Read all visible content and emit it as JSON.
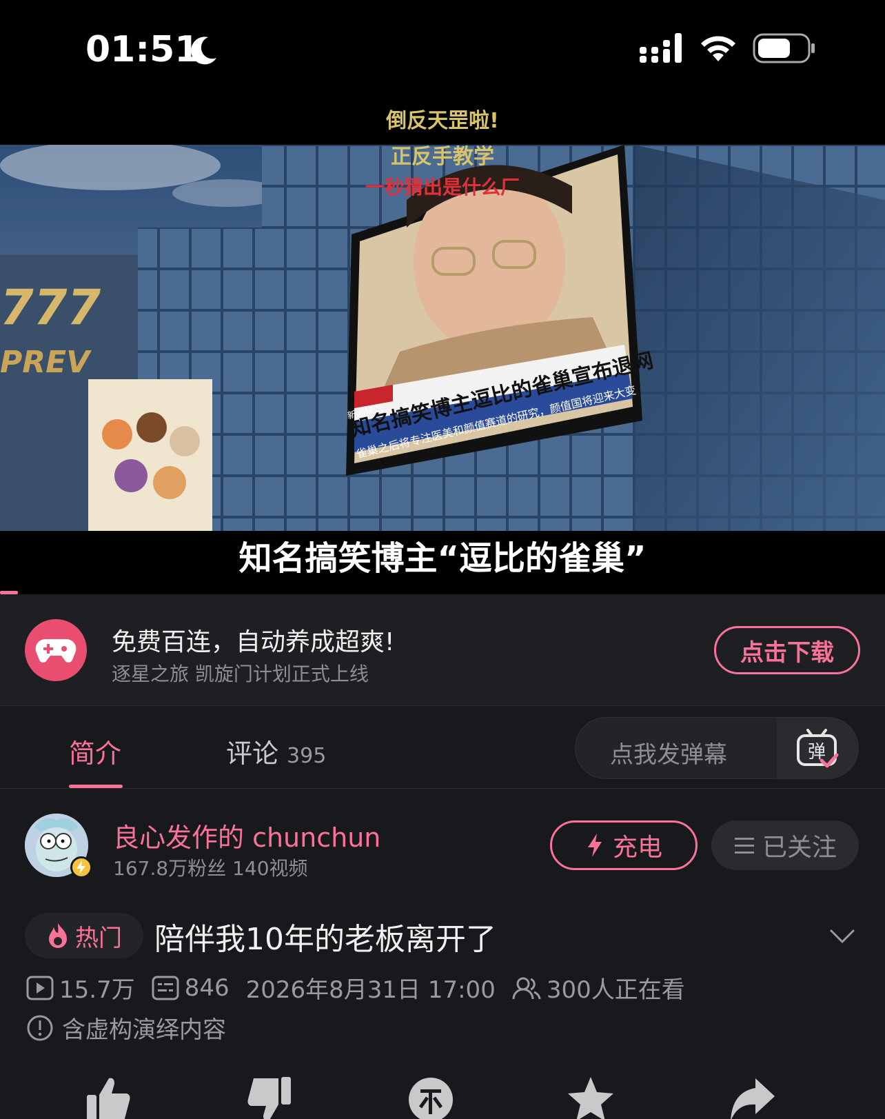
{
  "status_bar": {
    "time": "01:51"
  },
  "video": {
    "overlay_captions": [
      "倒反天罡啦!",
      "正反手教学",
      "一秒猜出是什么厂"
    ],
    "billboard_headline": "知名搞笑博主逗比的雀巢宣布退网",
    "billboard_sub": "雀巢之后将专注医美和颜值赛道的研究，颜值国将迎来大变",
    "billboard_tag": "新闻快讯",
    "subtitle": "知名搞笑博主“逗比的雀巢”",
    "progress_fraction": 0.02
  },
  "ad": {
    "title": "免费百连，自动养成超爽!",
    "subtitle": "逐星之旅 凯旋门计划正式上线",
    "button": "点击下载",
    "icon": "gamepad-icon"
  },
  "tabs": {
    "intro": "简介",
    "comments": "评论",
    "comments_count": "395",
    "danmaku_placeholder": "点我发弹幕",
    "danmaku_icon_label": "弹"
  },
  "uploader": {
    "name": "良心发作的 chunchun",
    "stats": "167.8万粉丝  140视频",
    "charge_label": "充电",
    "follow_label": "已关注"
  },
  "video_info": {
    "hot_label": "热门",
    "title": "陪伴我10年的老板离开了",
    "views": "15.7万",
    "danmaku_count": "846",
    "date": "2026年8月31日 17:00",
    "watching": "300人正在看",
    "notice": "含虚构演绎内容"
  },
  "colors": {
    "accent": "#fb7299",
    "background": "#18191c"
  }
}
